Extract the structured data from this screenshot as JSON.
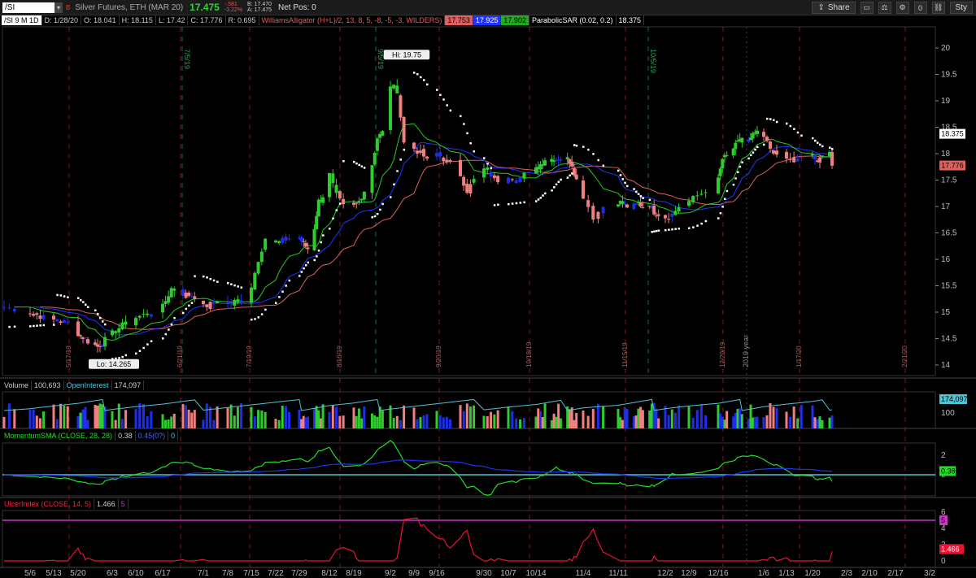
{
  "header": {
    "symbol": "/SI",
    "dropdown": "▾",
    "flag": "B",
    "title": "Silver Futures, ETH (MAR 20)",
    "last": "17.475",
    "change": "-.581",
    "change_pct": "-3.22%",
    "bid": "B: 17.470",
    "ask": "A: 17.475",
    "net_pos": "Net Pos: 0",
    "share_label": "Share",
    "zero_label": "0",
    "sty_label": "Sty"
  },
  "price_legend": {
    "symbol": "/SI 9 M 1D",
    "date": "D: 1/28/20",
    "open": "O: 18.041",
    "high": "H: 18.115",
    "low": "L: 17.42",
    "close": "C: 17.776",
    "range": "R: 0.695",
    "alligator": "WilliamsAlligator (H+L)/2, 13, 8, 5, -8, -5, -3, WILDERS)",
    "jaw": "17.753",
    "teeth": "17.925",
    "lips": "17.902",
    "sar_name": "ParabolicSAR (0.02, 0.2)",
    "sar_value": "18.375"
  },
  "volume_legend": {
    "name": "Volume",
    "value": "100,693",
    "oi_name": "OpenInterest",
    "oi_value": "174,097"
  },
  "momentum_legend": {
    "name": "MomentumSMA (CLOSE, 28, 28)",
    "value": "0.38",
    "value2": "0.45(0?)",
    "value3": "0"
  },
  "ulcer_legend": {
    "name": "UlcerIndex (CLOSE, 14, 5)",
    "value": "1.466",
    "value2": "5"
  },
  "markers": {
    "hi": "Hi: 19.75",
    "lo": "Lo: 14.265",
    "year": "2019 year"
  },
  "colors": {
    "up": "#2ecc2e",
    "down": "#f08080",
    "neutral": "#1f2ee8",
    "jaw": "#e0605a",
    "teeth": "#2233ff",
    "lips": "#22cc22",
    "momentum": "#22dd22",
    "momentum_sma": "#2233ee",
    "ulcer": "#ee1133",
    "ulcer_level": "#cc33cc",
    "oi": "#4fc3d4"
  },
  "chart_data": {
    "type": "line",
    "title": "Silver Futures, ETH (MAR 20)",
    "price_axis": {
      "ticks": [
        "20",
        "19.5",
        "19",
        "18.5",
        "18",
        "17.5",
        "17",
        "16.5",
        "16",
        "15.5",
        "15",
        "14.5",
        "14"
      ],
      "ylim": [
        13.8,
        20.4
      ]
    },
    "x_ticks": [
      "5/6",
      "5/13",
      "5/20",
      "6/3",
      "6/10",
      "6/17",
      "7/1",
      "7/8",
      "7/15",
      "7/22",
      "7/29",
      "8/12",
      "8/19",
      "9/2",
      "9/9",
      "9/16",
      "9/30",
      "10/7",
      "10/14",
      "11/4",
      "11/11",
      "12/2",
      "12/9",
      "12/16",
      "1/6",
      "1/13",
      "1/20",
      "2/3",
      "2/10",
      "2/17",
      "3/2"
    ],
    "period_labels": [
      "5/17/19",
      "6/21/19",
      "7/19/19",
      "8/16/19",
      "9/20/19",
      "10/18/19",
      "11/15/19",
      "12/20/19",
      "1/17/20",
      "2/21/20"
    ],
    "expiry_labels": [
      "7/5/19",
      "9/5/19",
      "10/5/19"
    ],
    "close_path": [
      [
        "5/1",
        15.1
      ],
      [
        "5/6",
        15.0
      ],
      [
        "5/10",
        14.9
      ],
      [
        "5/13",
        14.85
      ],
      [
        "5/17",
        14.8
      ],
      [
        "5/20",
        14.6
      ],
      [
        "5/24",
        14.45
      ],
      [
        "5/28",
        14.35
      ],
      [
        "6/3",
        14.6
      ],
      [
        "6/7",
        14.8
      ],
      [
        "6/10",
        14.9
      ],
      [
        "6/14",
        15.0
      ],
      [
        "6/17",
        15.1
      ],
      [
        "6/20",
        15.45
      ],
      [
        "6/24",
        15.35
      ],
      [
        "6/28",
        15.3
      ],
      [
        "7/1",
        15.1
      ],
      [
        "7/5",
        15.2
      ],
      [
        "7/8",
        15.15
      ],
      [
        "7/12",
        15.25
      ],
      [
        "7/15",
        15.5
      ],
      [
        "7/17",
        16.0
      ],
      [
        "7/19",
        16.4
      ],
      [
        "7/22",
        16.3
      ],
      [
        "7/26",
        16.4
      ],
      [
        "7/29",
        16.4
      ],
      [
        "8/2",
        16.2
      ],
      [
        "8/5",
        16.6
      ],
      [
        "8/7",
        17.1
      ],
      [
        "8/9",
        17.2
      ],
      [
        "8/12",
        17.6
      ],
      [
        "8/14",
        17.2
      ],
      [
        "8/16",
        17.0
      ],
      [
        "8/19",
        17.0
      ],
      [
        "8/21",
        17.1
      ],
      [
        "8/23",
        17.3
      ],
      [
        "8/26",
        17.8
      ],
      [
        "8/28",
        18.3
      ],
      [
        "8/30",
        18.4
      ],
      [
        "9/2",
        19.3
      ],
      [
        "9/4",
        19.2
      ],
      [
        "9/6",
        18.2
      ],
      [
        "9/9",
        18.1
      ],
      [
        "9/11",
        18.0
      ],
      [
        "9/13",
        17.9
      ],
      [
        "9/16",
        18.0
      ],
      [
        "9/18",
        17.9
      ],
      [
        "9/20",
        17.8
      ],
      [
        "9/23",
        17.6
      ],
      [
        "9/25",
        17.3
      ],
      [
        "9/27",
        17.5
      ],
      [
        "9/30",
        17.7
      ],
      [
        "10/2",
        17.6
      ],
      [
        "10/4",
        17.5
      ],
      [
        "10/7",
        17.6
      ],
      [
        "10/9",
        17.5
      ],
      [
        "10/11",
        17.6
      ],
      [
        "10/14",
        17.7
      ],
      [
        "10/16",
        17.8
      ],
      [
        "10/18",
        17.9
      ],
      [
        "10/21",
        17.9
      ],
      [
        "10/23",
        17.9
      ],
      [
        "10/25",
        17.9
      ],
      [
        "10/28",
        17.9
      ],
      [
        "10/30",
        17.8
      ],
      [
        "11/1",
        17.5
      ],
      [
        "11/4",
        17.2
      ],
      [
        "11/6",
        16.8
      ],
      [
        "11/8",
        17.0
      ],
      [
        "11/11",
        17.1
      ],
      [
        "11/13",
        17.05
      ],
      [
        "11/15",
        17.0
      ],
      [
        "11/18",
        17.0
      ],
      [
        "11/20",
        17.05
      ],
      [
        "11/22",
        17.0
      ],
      [
        "11/25",
        17.05
      ],
      [
        "11/27",
        16.9
      ],
      [
        "12/2",
        16.8
      ],
      [
        "12/4",
        16.85
      ],
      [
        "12/6",
        17.0
      ],
      [
        "12/9",
        17.1
      ],
      [
        "12/11",
        17.2
      ],
      [
        "12/13",
        17.3
      ],
      [
        "12/16",
        17.5
      ],
      [
        "12/18",
        17.9
      ],
      [
        "12/20",
        17.95
      ],
      [
        "12/23",
        18.1
      ],
      [
        "12/27",
        18.3
      ],
      [
        "12/30",
        18.2
      ],
      [
        "1/2",
        18.4
      ],
      [
        "1/6",
        18.3
      ],
      [
        "1/8",
        18.1
      ],
      [
        "1/10",
        18.0
      ],
      [
        "1/13",
        17.9
      ],
      [
        "1/15",
        17.85
      ],
      [
        "1/17",
        17.9
      ],
      [
        "1/20",
        18.0
      ],
      [
        "1/22",
        17.8
      ],
      [
        "1/24",
        18.0
      ],
      [
        "1/27",
        18.05
      ],
      [
        "1/28",
        17.776
      ]
    ],
    "hi": 19.75,
    "lo": 14.265,
    "last_price": 17.776,
    "sar_last": 18.375
  }
}
